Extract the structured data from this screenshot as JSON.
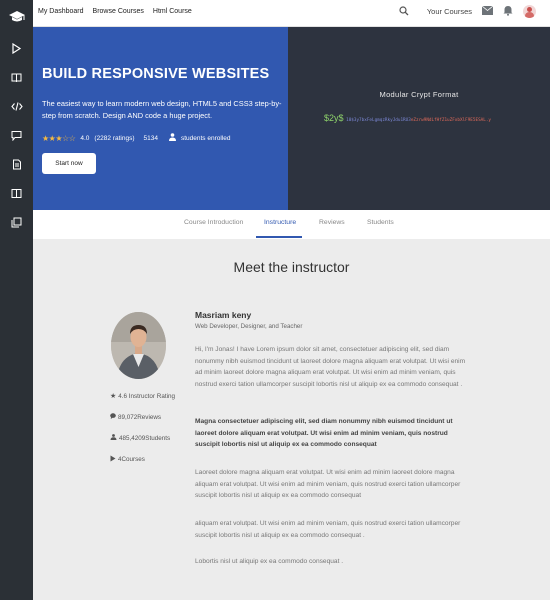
{
  "sidebar": {
    "logo_icon": "graduation-cap-icon",
    "items": [
      {
        "icon": "play-icon"
      },
      {
        "icon": "book-icon"
      },
      {
        "icon": "code-icon"
      },
      {
        "icon": "chat-icon"
      },
      {
        "icon": "document-icon"
      },
      {
        "icon": "open-book-icon"
      },
      {
        "icon": "copy-icon"
      }
    ]
  },
  "topbar": {
    "links": [
      "My Dashboard",
      "Browse Courses",
      "Html Course"
    ],
    "your_courses": "Your Courses"
  },
  "hero": {
    "title": "BUILD RESPONSIVE WEBSITES",
    "description": "The easiest way to learn modern web design, HTML5 and CSS3 step-by-step from scratch. Design AND code a huge project.",
    "rating": "4.0",
    "ratings_text": "(2282 ratings)",
    "enrolled_count": "5134",
    "enrolled_label": "students enrolled",
    "start_button": "Start now",
    "crypt_title": "Modular Crypt Format",
    "hash_alg": "$2y$",
    "hash_cost_salt": "10$3y7bxFeLgmqzRkyJdu1RU3",
    "hash_tail": "eZzrw9NdLfHfZ1uZFxbXlF9E5ESAL.y",
    "accent_color": "#3158b0",
    "dark_panel_color": "#2d333f"
  },
  "tabs": [
    "Course Introduction",
    "Instructure",
    "Reviews",
    "Students"
  ],
  "active_tab": "Instructure",
  "instructor": {
    "section_title": "Meet the instructor",
    "name": "Masriam keny",
    "role": "Web Developer, Designer, and Teacher",
    "stats": {
      "rating": "4.6 Instructor Rating",
      "reviews": "89,072Reviews",
      "students": "485,4209Students",
      "courses": "4Courses"
    },
    "paragraphs": [
      "Hi, I'm Jonas! I have Lorem ipsum dolor sit amet, consectetuer adipiscing elit, sed diam nonummy nibh euismod tincidunt ut laoreet dolore magna aliquam erat volutpat. Ut wisi enim ad minim laoreet dolore magna aliquam erat volutpat. Ut wisi enim ad minim veniam, quis nostrud exerci tation ullamcorper suscipit lobortis nisl ut aliquip ex ea commodo consequat .",
      "Magna consectetuer adipiscing elit, sed diam nonummy nibh euismod tincidunt ut laoreet dolore aliquam erat volutpat. Ut wisi enim ad minim veniam, quis nostrud suscipit lobortis nisl ut aliquip ex ea commodo consequat",
      "Laoreet dolore magna aliquam erat volutpat. Ut wisi enim ad minim laoreet dolore magna aliquam erat volutpat. Ut wisi enim ad minim veniam, quis nostrud exerci tation ullamcorper suscipit lobortis nisl ut aliquip ex ea commodo consequat",
      "aliquam erat volutpat. Ut wisi enim ad minim veniam, quis nostrud exerci tation ullamcorper suscipit lobortis nisl ut aliquip ex ea commodo consequat .",
      "Lobortis nisl ut aliquip ex ea commodo consequat ."
    ]
  }
}
